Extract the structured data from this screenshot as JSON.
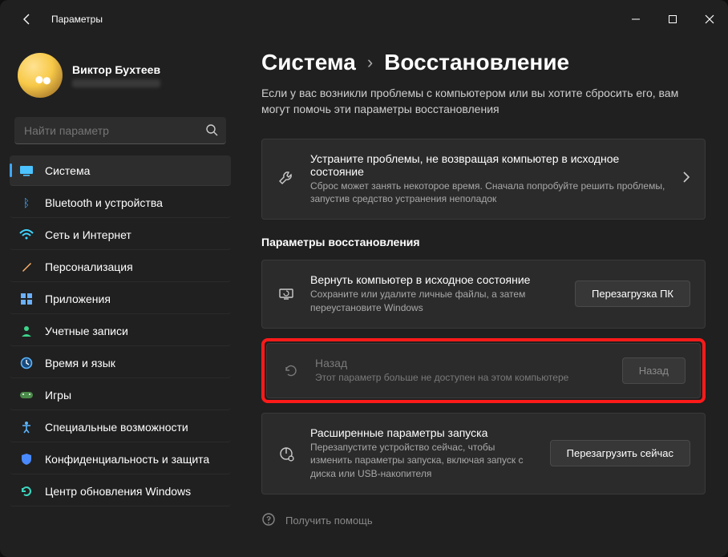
{
  "titlebar": {
    "app_title": "Параметры"
  },
  "profile": {
    "name": "Виктор Бухтеев"
  },
  "search": {
    "placeholder": "Найти параметр"
  },
  "sidebar": {
    "items": [
      {
        "label": "Система"
      },
      {
        "label": "Bluetooth и устройства"
      },
      {
        "label": "Сеть и Интернет"
      },
      {
        "label": "Персонализация"
      },
      {
        "label": "Приложения"
      },
      {
        "label": "Учетные записи"
      },
      {
        "label": "Время и язык"
      },
      {
        "label": "Игры"
      },
      {
        "label": "Специальные возможности"
      },
      {
        "label": "Конфиденциальность и защита"
      },
      {
        "label": "Центр обновления Windows"
      }
    ]
  },
  "breadcrumb": {
    "root": "Система",
    "sep": "›",
    "page": "Восстановление"
  },
  "page": {
    "subtitle": "Если у вас возникли проблемы с компьютером или вы хотите сбросить его, вам могут помочь эти параметры восстановления",
    "troubleshoot": {
      "title": "Устраните проблемы, не возвращая компьютер в исходное состояние",
      "desc": "Сброс может занять некоторое время. Сначала попробуйте решить проблемы, запустив средство устранения неполадок"
    },
    "section_header": "Параметры восстановления",
    "reset": {
      "title": "Вернуть компьютер в исходное состояние",
      "desc": "Сохраните или удалите личные файлы, а затем переустановите Windows",
      "button": "Перезагрузка ПК"
    },
    "goback": {
      "title": "Назад",
      "desc": "Этот параметр больше не доступен на этом компьютере",
      "button": "Назад"
    },
    "advanced": {
      "title": "Расширенные параметры запуска",
      "desc": "Перезапустите устройство сейчас, чтобы изменить параметры запуска, включая запуск с диска или USB-накопителя",
      "button": "Перезагрузить сейчас"
    },
    "help": "Получить помощь"
  }
}
